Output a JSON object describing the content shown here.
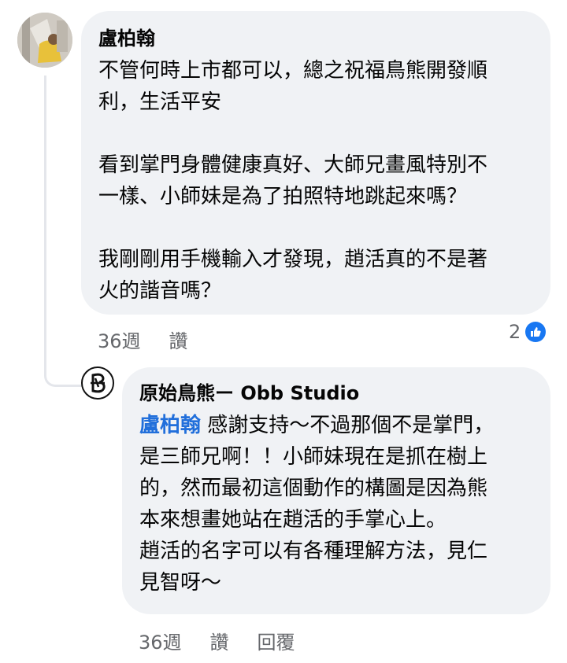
{
  "comment": {
    "author": "盧柏翰",
    "paragraphs": [
      [
        "不管何時上市都可以，總之祝福鳥熊開發順",
        "利，生活平安"
      ],
      [
        "看到掌門身體健康真好、大師兄畫風特別不",
        "一樣、小師妹是為了拍照特地跳起來嗎？"
      ],
      [
        "我剛剛用手機輸入才發現，趙活真的不是著",
        "火的諧音嗎？"
      ]
    ],
    "time": "36週",
    "like_label": "讚",
    "reaction_count": "2",
    "reaction_icon": "thumbs-up-icon"
  },
  "reply": {
    "author": "原始鳥熊ー Obb Studio",
    "mention": "盧柏翰",
    "lines": [
      " 感謝支持～不過那個不是掌門，",
      "是三師兄啊！！小師妹現在是抓在樹上",
      "的，然而最初這個動作的構圖是因為熊",
      "本來想畫她站在趙活的手掌心上。",
      "趙活的名字可以有各種理解方法，見仁",
      "見智呀～"
    ],
    "time": "36週",
    "like_label": "讚",
    "reply_label": "回覆"
  },
  "colors": {
    "bubble": "#f0f2f5",
    "mention": "#216fdb",
    "meta": "#65676b",
    "like_badge": "#1877f2"
  }
}
